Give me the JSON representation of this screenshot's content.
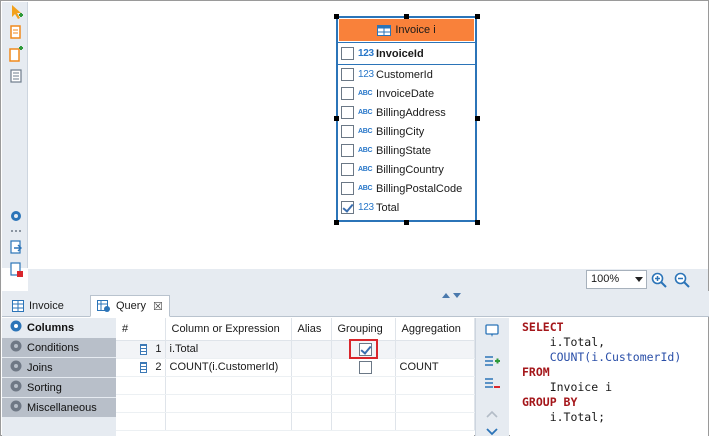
{
  "entity": {
    "title": "Invoice i",
    "primary_key": {
      "type": "123",
      "label": "InvoiceId",
      "checked": false
    },
    "columns": [
      {
        "type": "123",
        "label": "CustomerId",
        "checked": false
      },
      {
        "type": "ABC",
        "label": "InvoiceDate",
        "checked": false
      },
      {
        "type": "ABC",
        "label": "BillingAddress",
        "checked": false
      },
      {
        "type": "ABC",
        "label": "BillingCity",
        "checked": false
      },
      {
        "type": "ABC",
        "label": "BillingState",
        "checked": false
      },
      {
        "type": "ABC",
        "label": "BillingCountry",
        "checked": false
      },
      {
        "type": "ABC",
        "label": "BillingPostalCode",
        "checked": false
      },
      {
        "type": "123",
        "label": "Total",
        "checked": true
      }
    ]
  },
  "zoom": {
    "value": "100%"
  },
  "tabs": [
    {
      "label": "Invoice",
      "active": false
    },
    {
      "label": "Query",
      "active": true,
      "close": "☒"
    }
  ],
  "nav": [
    {
      "label": "Columns",
      "active": true
    },
    {
      "label": "Conditions",
      "active": false
    },
    {
      "label": "Joins",
      "active": false
    },
    {
      "label": "Sorting",
      "active": false
    },
    {
      "label": "Miscellaneous",
      "active": false
    }
  ],
  "grid": {
    "headers": [
      "#",
      "Column or Expression",
      "Alias",
      "Grouping",
      "Aggregation"
    ],
    "rows": [
      {
        "num": "1",
        "expression": "i.Total",
        "alias": "",
        "grouping": true,
        "aggregation": ""
      },
      {
        "num": "2",
        "expression": "COUNT(i.CustomerId)",
        "alias": "",
        "grouping": false,
        "aggregation": "COUNT"
      }
    ]
  },
  "sql": {
    "select": "SELECT",
    "line1": "    i.Total,",
    "line2_fn": "    COUNT(i.CustomerId)",
    "from": "FROM",
    "line3": "    Invoice i",
    "groupby": "GROUP BY",
    "line4": "    i.Total;"
  },
  "colors": {
    "header_orange": "#f9813a",
    "entity_border": "#2b74b8",
    "highlight_red": "#d9262c",
    "keyword_red": "#a4161a"
  }
}
